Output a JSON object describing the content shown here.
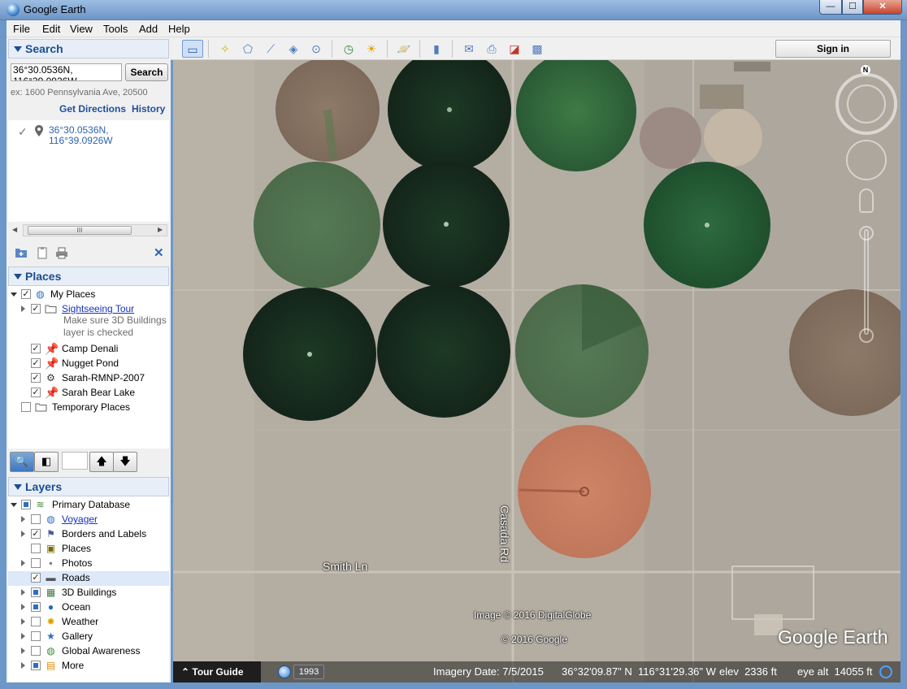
{
  "window": {
    "title": "Google Earth",
    "min": "—",
    "max": "☐",
    "close": "✕"
  },
  "menu": [
    "File",
    "Edit",
    "View",
    "Tools",
    "Add",
    "Help"
  ],
  "search": {
    "header": "Search",
    "query": "36°30.0536N, 116°39.0926W",
    "button": "Search",
    "hint": "ex: 1600 Pennsylvania Ave, 20500",
    "get_directions": "Get Directions",
    "history": "History",
    "result_line1": "36°30.0536N,",
    "result_line2": "116°39.0926W",
    "scroll_grip": "III"
  },
  "places": {
    "header": "Places",
    "items": [
      {
        "label": "My Places"
      },
      {
        "label": "Sightseeing Tour"
      },
      {
        "note1": "Make sure 3D Buildings",
        "note2": "layer is checked"
      },
      {
        "label": "Camp Denali"
      },
      {
        "label": "Nugget Pond"
      },
      {
        "label": "Sarah-RMNP-2007"
      },
      {
        "label": "Sarah Bear Lake"
      },
      {
        "label": "Temporary Places"
      }
    ]
  },
  "layers": {
    "header": "Layers",
    "items": [
      {
        "label": "Primary Database"
      },
      {
        "label": "Voyager"
      },
      {
        "label": "Borders and Labels"
      },
      {
        "label": "Places"
      },
      {
        "label": "Photos"
      },
      {
        "label": "Roads"
      },
      {
        "label": "3D Buildings"
      },
      {
        "label": "Ocean"
      },
      {
        "label": "Weather"
      },
      {
        "label": "Gallery"
      },
      {
        "label": "Global Awareness"
      },
      {
        "label": "More"
      }
    ]
  },
  "toolbar": {
    "sign_in": "Sign in"
  },
  "map": {
    "road1": "Smith Ln",
    "road2": "Casada Rd",
    "attribution1": "Image © 2016 DigitalGlobe",
    "attribution2": "© 2016 Google",
    "brand": "Google Earth",
    "compass_n": "N"
  },
  "status": {
    "tour_guide": "Tour Guide",
    "year": "1993",
    "imagery_date": "Imagery Date: 7/5/2015",
    "lat": "36°32'09.87\" N",
    "lon": "116°31'29.36\" W",
    "elev": "elev  2336 ft",
    "eye_alt": "eye alt  14055 ft"
  },
  "colors": {
    "accent": "#1a4e92",
    "link": "#1432c4",
    "result_link": "#2d63b0"
  }
}
